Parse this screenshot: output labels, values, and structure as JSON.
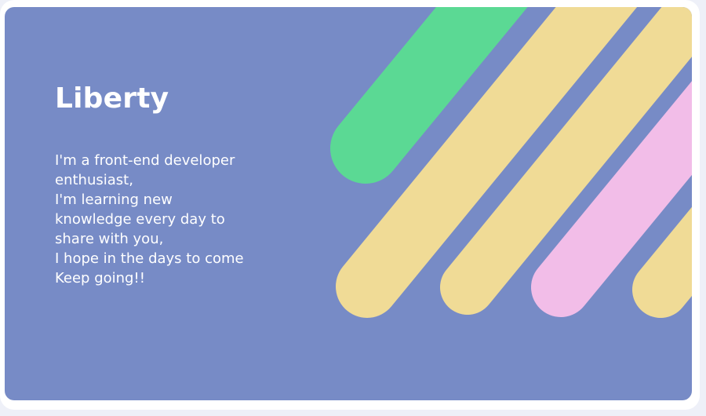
{
  "card": {
    "title": "Liberty",
    "bio_lines": [
      "I'm a front-end developer",
      "enthusiast,",
      "I'm learning new",
      "knowledge every day to",
      "share with you,",
      "I hope in the days to come",
      "Keep going!!"
    ]
  },
  "colors": {
    "page_background": "#eef0f8",
    "frame": "#ffffff",
    "card_background": "#778bc6",
    "text": "#ffffff",
    "stripe_green": "#5bd994",
    "stripe_yellow": "#f0db96",
    "stripe_pink": "#f2bde8"
  }
}
